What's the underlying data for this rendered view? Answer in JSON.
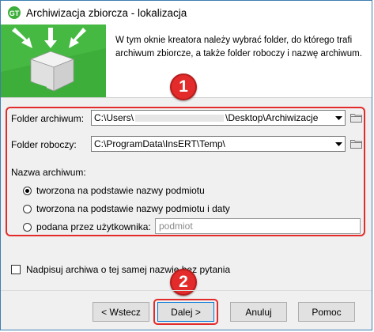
{
  "window": {
    "title": "Archiwizacja zbiorcza - lokalizacja"
  },
  "header": {
    "description": "W tym oknie kreatora należy wybrać folder, do którego trafi archiwum zbiorcze, a także folder roboczy i nazwę archiwum."
  },
  "callouts": {
    "first": "1",
    "second": "2"
  },
  "form": {
    "archive_folder_label": "Folder archiwum:",
    "archive_folder_prefix": "C:\\Users\\",
    "archive_folder_suffix": "\\Desktop\\Archiwizacje",
    "work_folder_label": "Folder roboczy:",
    "work_folder_value": "C:\\ProgramData\\InsERT\\Temp\\",
    "archive_name_label": "Nazwa archiwum:",
    "radio_options": [
      {
        "label": "tworzona na podstawie nazwy podmiotu",
        "checked": true
      },
      {
        "label": "tworzona na podstawie nazwy podmiotu i daty",
        "checked": false
      },
      {
        "label": "podana przez użytkownika:",
        "checked": false
      }
    ],
    "user_name_placeholder": "podmiot",
    "overwrite_label": "Nadpisuj archiwa o tej samej nazwie bez pytania"
  },
  "buttons": {
    "back": "< Wstecz",
    "next": "Dalej >",
    "cancel": "Anuluj",
    "help": "Pomoc"
  },
  "colors": {
    "accent_red": "#e32b2b",
    "window_border": "#3c7fb1",
    "header_green": "#3dae3a"
  }
}
